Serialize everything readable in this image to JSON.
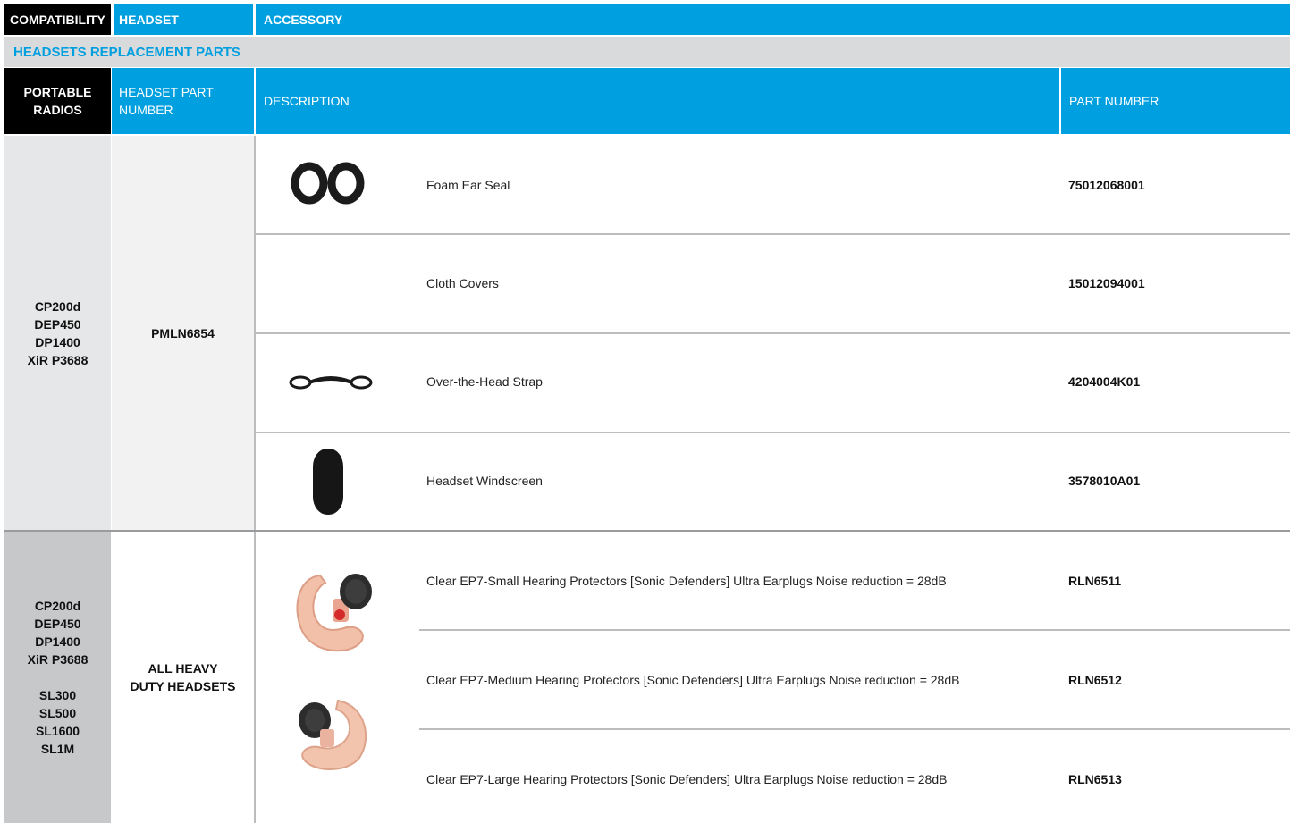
{
  "tabs": {
    "compatibility": "COMPATIBILITY",
    "headset": "HEADSET",
    "accessory": "ACCESSORY"
  },
  "section_title": "HEADSETS REPLACEMENT PARTS",
  "headers": {
    "radios_line1": "PORTABLE",
    "radios_line2": "RADIOS",
    "part_line1": "HEADSET PART",
    "part_line2": "NUMBER",
    "description": "DESCRIPTION",
    "part_number": "PART NUMBER"
  },
  "groups": [
    {
      "radios": [
        "CP200d",
        "DEP450",
        "DP1400",
        "XiR P3688"
      ],
      "headset": "PMLN6854",
      "items": [
        {
          "icon": "foam-ear-seal-image",
          "description": "Foam Ear Seal",
          "part_number": "75012068001"
        },
        {
          "icon": "",
          "description": "Cloth Covers",
          "part_number": "15012094001"
        },
        {
          "icon": "head-strap-image",
          "description": "Over-the-Head Strap",
          "part_number": "4204004K01"
        },
        {
          "icon": "windscreen-image",
          "description": "Headset Windscreen",
          "part_number": "3578010A01"
        }
      ]
    },
    {
      "radios": [
        "CP200d",
        "DEP450",
        "DP1400",
        "XiR P3688"
      ],
      "radios_b": [
        "SL300",
        "SL500",
        "SL1600",
        "SL1M"
      ],
      "headset_line1": "ALL HEAVY",
      "headset_line2": "DUTY HEADSETS",
      "items": [
        {
          "icon": "earplug-image",
          "description": "Clear EP7-Small Hearing Protectors [Sonic Defenders] Ultra Earplugs Noise reduction = 28dB",
          "part_number": "RLN6511"
        },
        {
          "icon": "earplug-image",
          "description": "Clear EP7-Medium Hearing Protectors [Sonic Defenders] Ultra Earplugs Noise reduction = 28dB",
          "part_number": "RLN6512"
        },
        {
          "icon": "",
          "description": "Clear EP7-Large Hearing Protectors [Sonic Defenders] Ultra Earplugs Noise reduction = 28dB",
          "part_number": "RLN6513"
        }
      ]
    }
  ],
  "colors": {
    "accent": "#009fdf",
    "black": "#000000",
    "group1_bg": "#e6e7e8",
    "group2_bg": "#c6c8ca"
  }
}
